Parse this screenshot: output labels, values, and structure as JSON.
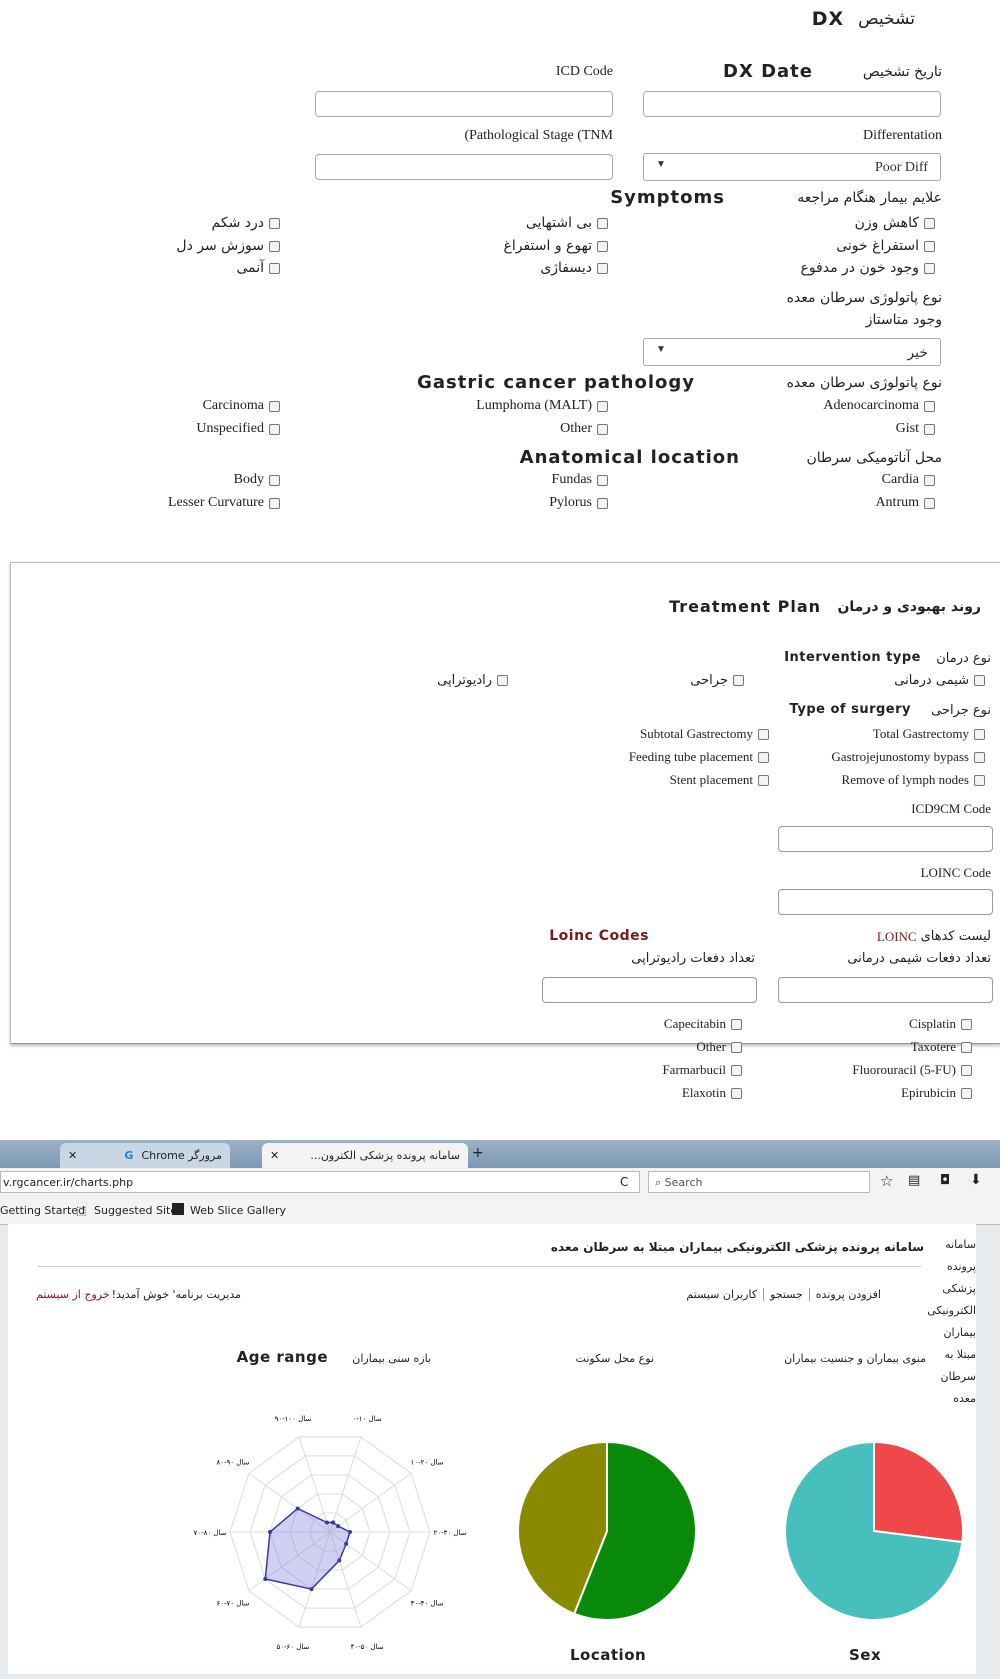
{
  "dx": {
    "title_fa": "تشخیص",
    "title_en": "DX",
    "dx_date_fa": "تاریخ تشخیص",
    "dx_date_en": "DX Date",
    "icd_code": "ICD Code",
    "differentiation": "Differentation",
    "pathological_stage": "(Pathological Stage (TNM",
    "diff_select_value": "Poor Diff",
    "symptoms_fa": "علایم بیمار هنگام مراجعه",
    "symptoms_en": "Symptoms",
    "symptoms": [
      [
        "کاهش وزن",
        "بی اشتهایی",
        "درد شکم"
      ],
      [
        "استفراغ خونی",
        "تهوع و استفراغ",
        "سوزش سر دل"
      ],
      [
        "وجود خون در مدفوع",
        "دیسفاژی",
        "آنمی"
      ]
    ],
    "pathology_type_fa": "نوع پاتولوژی سرطان معده",
    "metastasis_fa": "وجود متاستاز",
    "metastasis_value": "خیر",
    "gastric_fa": "نوع پاتولوژی سرطان معده",
    "gastric_en": "Gastric cancer pathology",
    "gastric_items": [
      [
        "Adenocarcinoma",
        "(Lumphoma (MALT",
        "Carcinoma"
      ],
      [
        "Gist",
        "Other",
        "Unspecified"
      ]
    ],
    "anatomical_fa": "محل آناتومیکی سرطان",
    "anatomical_en": "Anatomical location",
    "anatomical_items": [
      [
        "Cardia",
        "Fundas",
        "Body"
      ],
      [
        "Antrum",
        "Pylorus",
        "Lesser Curvature"
      ]
    ]
  },
  "treatment": {
    "title_fa": "روند بهبودی و درمان",
    "title_en": "Treatment Plan",
    "intervention_fa": "نوع درمان",
    "intervention_en": "Intervention type",
    "interventions": [
      "شیمی درمانی",
      "جراحی",
      "رادیوتراپی"
    ],
    "surgery_fa": "نوع جراحی",
    "surgery_en": "Type of surgery",
    "surgery_items": [
      [
        "Total Gastrectomy",
        "Subtotal Gastrectomy"
      ],
      [
        "Gastrojejunostomy bypass",
        "Feeding tube placement"
      ],
      [
        "Remove of lymph nodes",
        "Stent placement"
      ]
    ],
    "icd9": "ICD9CM Code",
    "loinc": "LOINC Code",
    "loinc_list_fa": "لیست کدهای",
    "loinc_list_en": "LOINC",
    "loinc_codes": "Loinc Codes",
    "chemo_count_fa": "تعداد دفعات شیمی درمانی",
    "radio_count_fa": "تعداد دفعات رادیوتراپی",
    "drugs": [
      [
        "Cisplatin",
        "Capecitabin"
      ],
      [
        "Taxotere",
        "Other"
      ],
      [
        "(Fluorouracil (5-FU",
        "Farmarbucil"
      ],
      [
        "Epirubicin",
        "Elaxotin"
      ]
    ]
  },
  "browser": {
    "tab1": "مرورگر Chrome",
    "tab2": "سامانه پرونده پزشکی الکترون...",
    "url": "v.rgcancer.ir/charts.php",
    "search_placeholder": "Search",
    "bookmarks": [
      "Getting Started",
      "Suggested Sites",
      "Web Slice Gallery"
    ],
    "page_title": "سامانه پرونده پزشکی الکترونیکی بیماران مبتلا به سرطان معده",
    "side_nav": [
      "سامانه",
      "پرونده",
      "پزشکی",
      "الکترونیکی",
      "بیماران",
      "مبتلا به",
      "سرطان",
      "معده"
    ],
    "menu": [
      "افزودن پرونده",
      "جستجو",
      "کاربران سیستم"
    ],
    "welcome": "مدیریت برنامه' خوش آمدید!",
    "logout": "خروج از سیستم",
    "chart1_title_fa": "منوی بیماران و جنسیت بیماران",
    "chart2_title_fa": "نوع محل سکونت",
    "chart3_title_fa": "بازه سنی بیماران",
    "age_range": "Age range",
    "location": "Location",
    "sex": "Sex",
    "colors": {
      "red": "#f0474a",
      "teal": "#46bfbd",
      "green": "#0a8a0a",
      "olive": "#8a8a00",
      "radar": "#3a3a9a"
    }
  },
  "chart_data": [
    {
      "type": "pie",
      "title": "Sex",
      "values": [
        0.27,
        0.73
      ],
      "colors": [
        "#f0474a",
        "#46bfbd"
      ]
    },
    {
      "type": "pie",
      "title": "Location",
      "values": [
        0.56,
        0.44
      ],
      "colors": [
        "#0a8a0a",
        "#8a8a00"
      ]
    },
    {
      "type": "radar",
      "title": "Age range",
      "categories": [
        "۰-۱۰ سال",
        "۱۰-۲۰ سال",
        "۲۰-۳۰ سال",
        "۳۰-۴۰ سال",
        "۴۰-۵۰ سال",
        "۵۰-۶۰ سال",
        "۶۰-۷۰ سال",
        "۷۰-۸۰ سال",
        "۸۰-۹۰ سال",
        "۹۰-۱۰۰ سال"
      ],
      "values": [
        1,
        1,
        2,
        2,
        3,
        6,
        8,
        6,
        4,
        1
      ],
      "max": 10
    }
  ]
}
